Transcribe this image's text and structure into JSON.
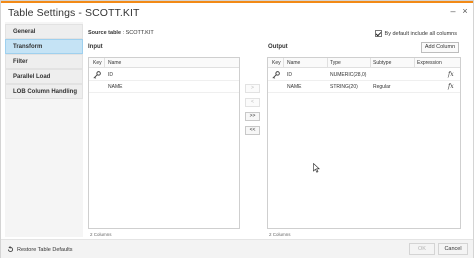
{
  "window": {
    "title": "Table Settings - SCOTT.KIT",
    "accent_color": "#f28a17",
    "controls": [
      "minimize-icon",
      "close-icon"
    ],
    "minimize_glyph": "–",
    "close_glyph": "×"
  },
  "sidebar": {
    "items": [
      {
        "label": "General",
        "active": false
      },
      {
        "label": "Transform",
        "active": true
      },
      {
        "label": "Filter",
        "active": false
      },
      {
        "label": "Parallel Load",
        "active": false
      },
      {
        "label": "LOB Column Handling",
        "active": false
      }
    ],
    "active_color": "#c5e3f5"
  },
  "main": {
    "source_label": "Source table",
    "source_value": ": SCOTT.KIT",
    "default_include_label": "By default include all columns",
    "default_include_checked": true,
    "input_label": "Input",
    "output_label": "Output",
    "add_column_label": "Add Column"
  },
  "input_table": {
    "headers": [
      "Key",
      "Name"
    ],
    "rows": [
      {
        "key": true,
        "name": "ID"
      },
      {
        "key": false,
        "name": "NAME"
      }
    ],
    "count": "2 Columns"
  },
  "movers": [
    ">",
    "<",
    ">>",
    "<<"
  ],
  "output_table": {
    "headers": [
      "Key",
      "Name",
      "Type",
      "Subtype",
      "Expression"
    ],
    "rows": [
      {
        "key": true,
        "name": "ID",
        "type": "NUMERIC(28,0)",
        "subtype": "",
        "expression": "fx"
      },
      {
        "key": false,
        "name": "NAME",
        "type": "STRING(20)",
        "subtype": "Regular",
        "expression": "fx"
      }
    ],
    "count": "2 Columns"
  },
  "footer": {
    "restore_label": "Restore Table Defaults",
    "ok_label": "OK",
    "cancel_label": "Cancel"
  }
}
